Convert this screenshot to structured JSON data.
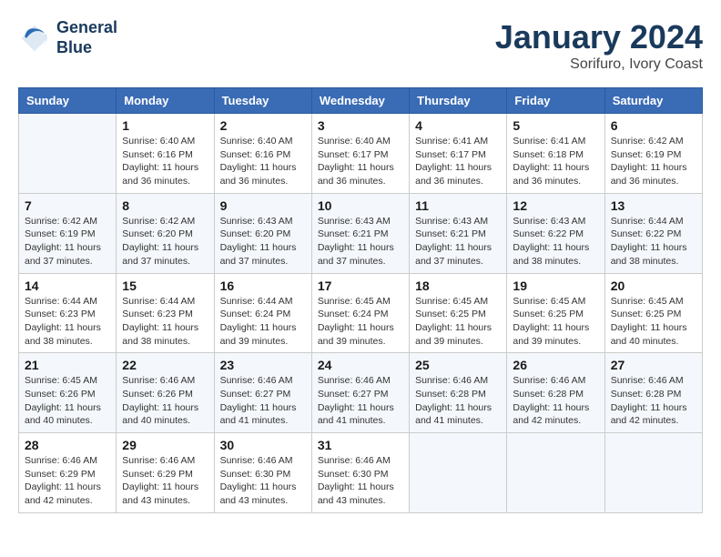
{
  "header": {
    "logo_line1": "General",
    "logo_line2": "Blue",
    "month": "January 2024",
    "location": "Sorifuro, Ivory Coast"
  },
  "days_of_week": [
    "Sunday",
    "Monday",
    "Tuesday",
    "Wednesday",
    "Thursday",
    "Friday",
    "Saturday"
  ],
  "weeks": [
    [
      {
        "day": "",
        "info": ""
      },
      {
        "day": "1",
        "info": "Sunrise: 6:40 AM\nSunset: 6:16 PM\nDaylight: 11 hours and 36 minutes."
      },
      {
        "day": "2",
        "info": "Sunrise: 6:40 AM\nSunset: 6:16 PM\nDaylight: 11 hours and 36 minutes."
      },
      {
        "day": "3",
        "info": "Sunrise: 6:40 AM\nSunset: 6:17 PM\nDaylight: 11 hours and 36 minutes."
      },
      {
        "day": "4",
        "info": "Sunrise: 6:41 AM\nSunset: 6:17 PM\nDaylight: 11 hours and 36 minutes."
      },
      {
        "day": "5",
        "info": "Sunrise: 6:41 AM\nSunset: 6:18 PM\nDaylight: 11 hours and 36 minutes."
      },
      {
        "day": "6",
        "info": "Sunrise: 6:42 AM\nSunset: 6:19 PM\nDaylight: 11 hours and 36 minutes."
      }
    ],
    [
      {
        "day": "7",
        "info": "Sunrise: 6:42 AM\nSunset: 6:19 PM\nDaylight: 11 hours and 37 minutes."
      },
      {
        "day": "8",
        "info": "Sunrise: 6:42 AM\nSunset: 6:20 PM\nDaylight: 11 hours and 37 minutes."
      },
      {
        "day": "9",
        "info": "Sunrise: 6:43 AM\nSunset: 6:20 PM\nDaylight: 11 hours and 37 minutes."
      },
      {
        "day": "10",
        "info": "Sunrise: 6:43 AM\nSunset: 6:21 PM\nDaylight: 11 hours and 37 minutes."
      },
      {
        "day": "11",
        "info": "Sunrise: 6:43 AM\nSunset: 6:21 PM\nDaylight: 11 hours and 37 minutes."
      },
      {
        "day": "12",
        "info": "Sunrise: 6:43 AM\nSunset: 6:22 PM\nDaylight: 11 hours and 38 minutes."
      },
      {
        "day": "13",
        "info": "Sunrise: 6:44 AM\nSunset: 6:22 PM\nDaylight: 11 hours and 38 minutes."
      }
    ],
    [
      {
        "day": "14",
        "info": "Sunrise: 6:44 AM\nSunset: 6:23 PM\nDaylight: 11 hours and 38 minutes."
      },
      {
        "day": "15",
        "info": "Sunrise: 6:44 AM\nSunset: 6:23 PM\nDaylight: 11 hours and 38 minutes."
      },
      {
        "day": "16",
        "info": "Sunrise: 6:44 AM\nSunset: 6:24 PM\nDaylight: 11 hours and 39 minutes."
      },
      {
        "day": "17",
        "info": "Sunrise: 6:45 AM\nSunset: 6:24 PM\nDaylight: 11 hours and 39 minutes."
      },
      {
        "day": "18",
        "info": "Sunrise: 6:45 AM\nSunset: 6:25 PM\nDaylight: 11 hours and 39 minutes."
      },
      {
        "day": "19",
        "info": "Sunrise: 6:45 AM\nSunset: 6:25 PM\nDaylight: 11 hours and 39 minutes."
      },
      {
        "day": "20",
        "info": "Sunrise: 6:45 AM\nSunset: 6:25 PM\nDaylight: 11 hours and 40 minutes."
      }
    ],
    [
      {
        "day": "21",
        "info": "Sunrise: 6:45 AM\nSunset: 6:26 PM\nDaylight: 11 hours and 40 minutes."
      },
      {
        "day": "22",
        "info": "Sunrise: 6:46 AM\nSunset: 6:26 PM\nDaylight: 11 hours and 40 minutes."
      },
      {
        "day": "23",
        "info": "Sunrise: 6:46 AM\nSunset: 6:27 PM\nDaylight: 11 hours and 41 minutes."
      },
      {
        "day": "24",
        "info": "Sunrise: 6:46 AM\nSunset: 6:27 PM\nDaylight: 11 hours and 41 minutes."
      },
      {
        "day": "25",
        "info": "Sunrise: 6:46 AM\nSunset: 6:28 PM\nDaylight: 11 hours and 41 minutes."
      },
      {
        "day": "26",
        "info": "Sunrise: 6:46 AM\nSunset: 6:28 PM\nDaylight: 11 hours and 42 minutes."
      },
      {
        "day": "27",
        "info": "Sunrise: 6:46 AM\nSunset: 6:28 PM\nDaylight: 11 hours and 42 minutes."
      }
    ],
    [
      {
        "day": "28",
        "info": "Sunrise: 6:46 AM\nSunset: 6:29 PM\nDaylight: 11 hours and 42 minutes."
      },
      {
        "day": "29",
        "info": "Sunrise: 6:46 AM\nSunset: 6:29 PM\nDaylight: 11 hours and 43 minutes."
      },
      {
        "day": "30",
        "info": "Sunrise: 6:46 AM\nSunset: 6:30 PM\nDaylight: 11 hours and 43 minutes."
      },
      {
        "day": "31",
        "info": "Sunrise: 6:46 AM\nSunset: 6:30 PM\nDaylight: 11 hours and 43 minutes."
      },
      {
        "day": "",
        "info": ""
      },
      {
        "day": "",
        "info": ""
      },
      {
        "day": "",
        "info": ""
      }
    ]
  ]
}
